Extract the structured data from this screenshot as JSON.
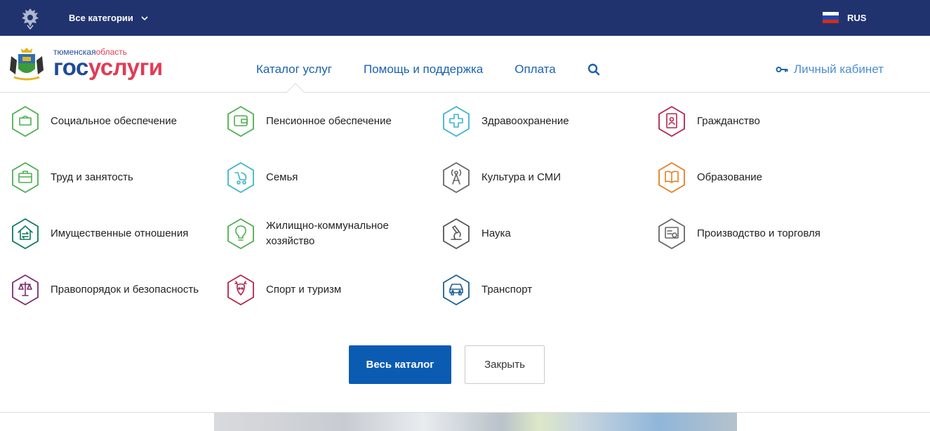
{
  "topbar": {
    "categories_label": "Все категории",
    "language": "RUS",
    "colors": {
      "background": "#20336f",
      "flag": [
        "#ffffff",
        "#1c47b0",
        "#d52b1e"
      ]
    }
  },
  "header": {
    "region_part1": "тюменская",
    "region_part2": "область",
    "brand_part1": "гос",
    "brand_part2": "услуги",
    "nav": {
      "catalog": "Каталог услуг",
      "help": "Помощь и поддержка",
      "payment": "Оплата"
    },
    "cabinet": "Личный кабинет"
  },
  "categories": [
    {
      "label": "Социальное обеспечение",
      "icon": "wallet-icon",
      "color": "#4caf50"
    },
    {
      "label": "Пенсионное обеспечение",
      "icon": "purse-icon",
      "color": "#4caf50"
    },
    {
      "label": "Здравоохранение",
      "icon": "medical-cross-icon",
      "color": "#3cb6c7"
    },
    {
      "label": "Гражданство",
      "icon": "passport-icon",
      "color": "#b3254d"
    },
    {
      "label": "Труд и занятость",
      "icon": "briefcase-icon",
      "color": "#4caf50"
    },
    {
      "label": "Семья",
      "icon": "stroller-icon",
      "color": "#3cb6c7"
    },
    {
      "label": "Культура и СМИ",
      "icon": "broadcast-tower-icon",
      "color": "#666666"
    },
    {
      "label": "Образование",
      "icon": "book-icon",
      "color": "#e67e22"
    },
    {
      "label": "Имущественные отношения",
      "icon": "house-exchange-icon",
      "color": "#0a7a5c"
    },
    {
      "label": "Жилищно-коммунальное хозяйство",
      "icon": "lightbulb-icon",
      "color": "#4caf50"
    },
    {
      "label": "Наука",
      "icon": "microscope-icon",
      "color": "#555555"
    },
    {
      "label": "Производство и торговля",
      "icon": "certificate-icon",
      "color": "#666666"
    },
    {
      "label": "Правопорядок и безопасность",
      "icon": "scales-icon",
      "color": "#7b2d6e"
    },
    {
      "label": "Спорт и туризм",
      "icon": "deer-icon",
      "color": "#b3254d"
    },
    {
      "label": "Транспорт",
      "icon": "car-icon",
      "color": "#1f5f8f"
    }
  ],
  "buttons": {
    "all_catalog": "Весь каталог",
    "close": "Закрыть"
  },
  "accent_color": "#0b5bb3"
}
